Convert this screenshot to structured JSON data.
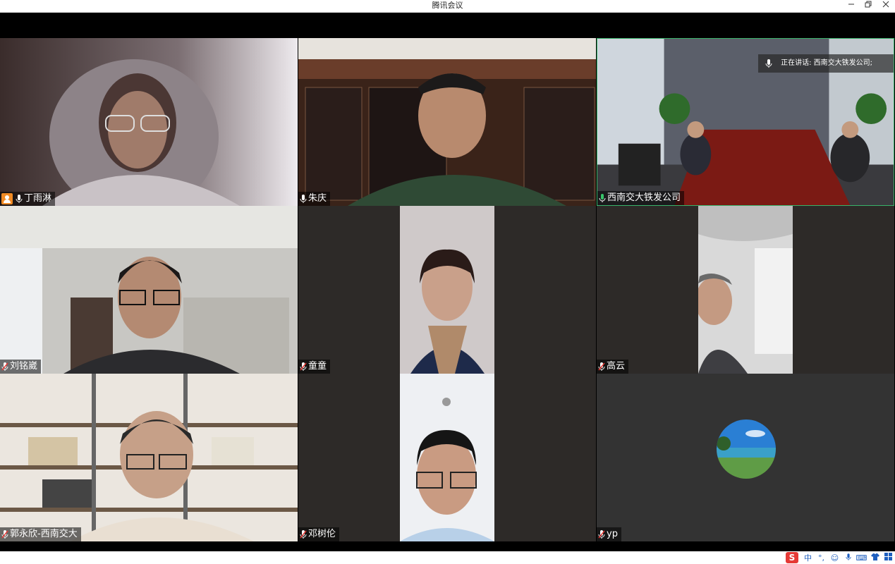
{
  "window": {
    "title": "腾讯会议",
    "minimize_icon": "minimize-icon",
    "restore_icon": "restore-icon",
    "close_icon": "close-icon"
  },
  "speaking": {
    "label": "正在讲话: 西南交大铁发公司;"
  },
  "participants": [
    {
      "name": "丁雨淋",
      "host": true,
      "mic": "on"
    },
    {
      "name": "朱庆",
      "mic": "on"
    },
    {
      "name": "西南交大铁发公司",
      "mic": "speaking",
      "active": true
    },
    {
      "name": "刘铭崴",
      "mic": "muted"
    },
    {
      "name": "童童",
      "mic": "muted"
    },
    {
      "name": "高云",
      "mic": "muted"
    },
    {
      "name": "郭永欣-西南交大",
      "mic": "muted"
    },
    {
      "name": "邓树伦",
      "mic": "muted"
    },
    {
      "name": "yp",
      "mic": "muted"
    }
  ],
  "ime": {
    "logo": "S",
    "mode": "中",
    "punct": "°,",
    "items": [
      "smile-icon",
      "mic-icon",
      "keyboard-icon",
      "shirt-icon",
      "grid-icon"
    ]
  }
}
